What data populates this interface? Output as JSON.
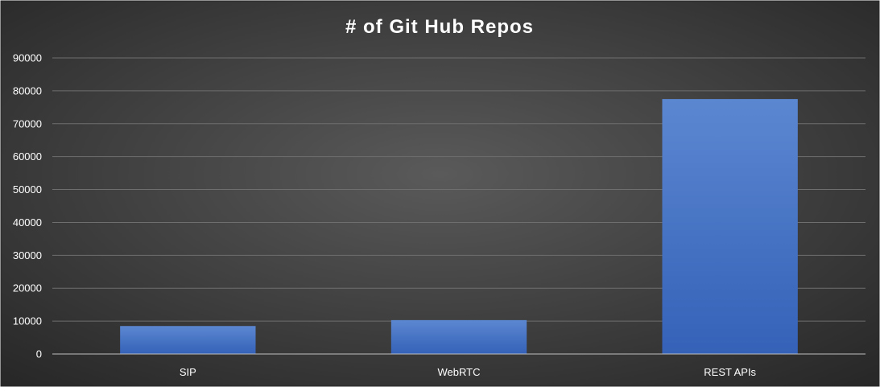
{
  "chart_data": {
    "type": "bar",
    "title": "# of Git Hub Repos",
    "categories": [
      "SIP",
      "WebRTC",
      "REST APIs"
    ],
    "values": [
      8500,
      10300,
      77500
    ],
    "ylim": [
      0,
      90000
    ],
    "yticks": [
      "0",
      "10000",
      "20000",
      "30000",
      "40000",
      "50000",
      "60000",
      "70000",
      "80000",
      "90000"
    ],
    "grid": true,
    "legend": "none"
  },
  "colors": {
    "background_center": "#5a5a5a",
    "background_edge": "#262626",
    "bar_top": "#5b87d1",
    "bar_bottom": "#3561b8",
    "gridline": "#6e6e6e",
    "axis": "#bfbfbf",
    "text": "#ffffff"
  }
}
